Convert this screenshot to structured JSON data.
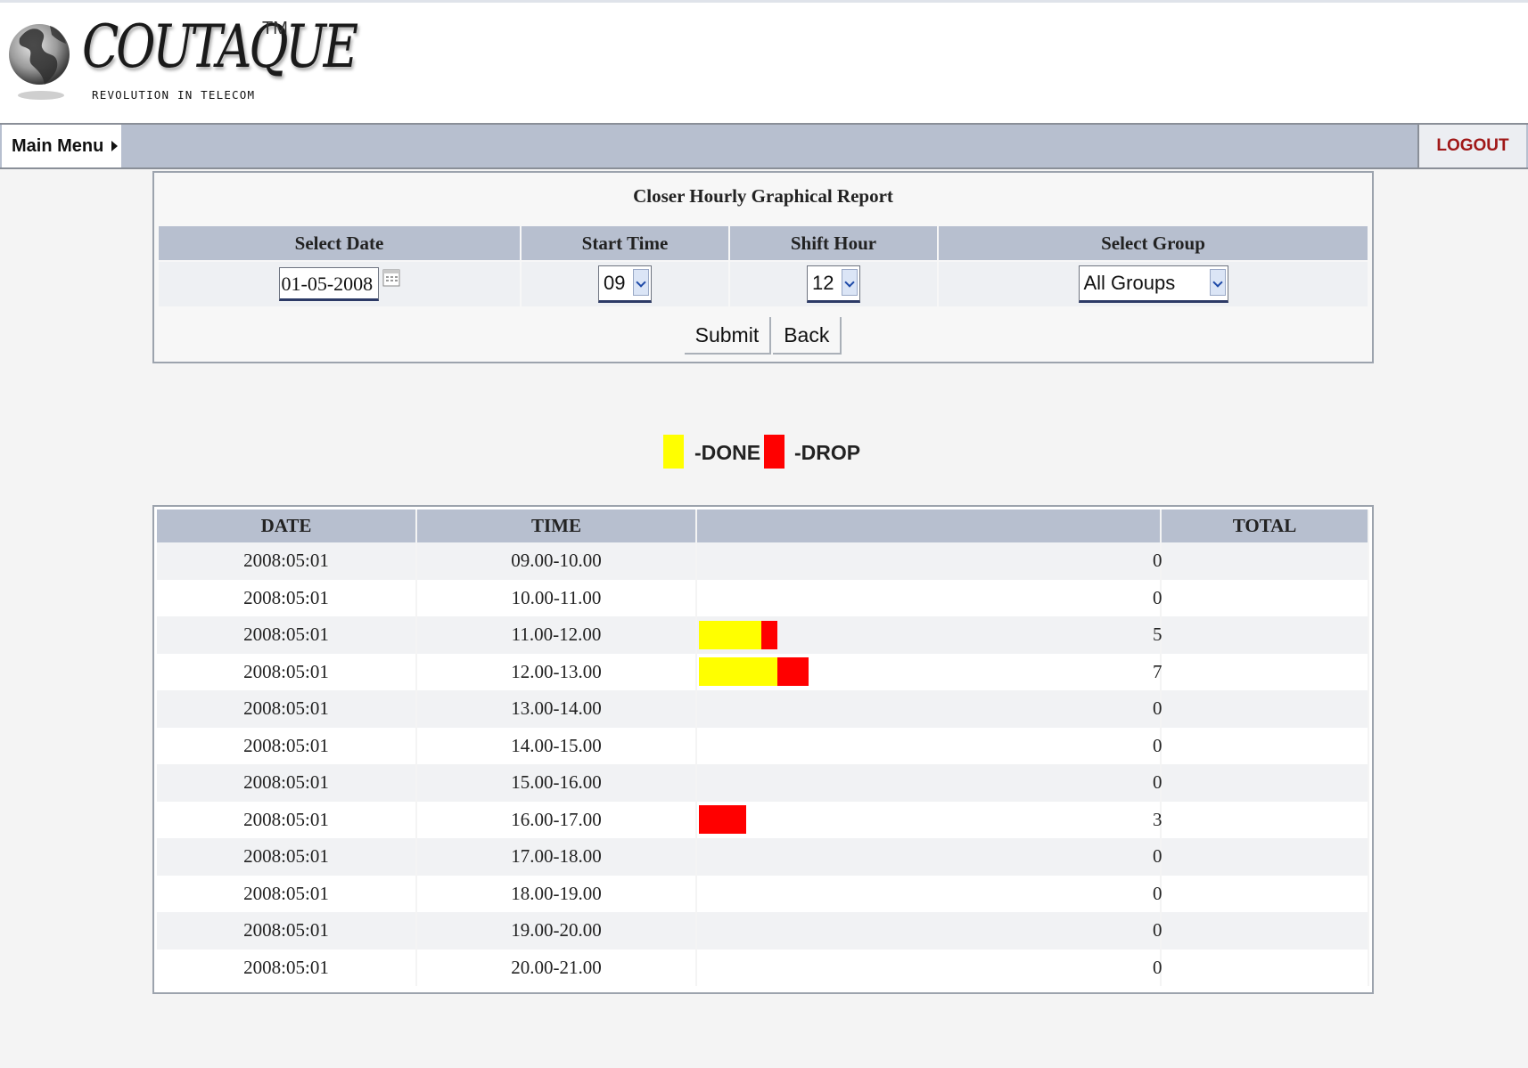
{
  "header": {
    "brand": "COUTAQUE",
    "trademark": "TM",
    "tagline": "REVOLUTION IN TELECOM"
  },
  "nav": {
    "main_menu_label": "Main Menu",
    "logout_label": "LOGOUT"
  },
  "form": {
    "title": "Closer Hourly Graphical Report",
    "columns": [
      "Select Date",
      "Start Time",
      "Shift Hour",
      "Select Group"
    ],
    "date_value": "01-05-2008",
    "start_time": "09",
    "shift_hour": "12",
    "group": "All Groups",
    "submit_label": "Submit",
    "back_label": "Back"
  },
  "legend": {
    "done_label": "-DONE",
    "drop_label": "-DROP",
    "done_color": "#ffff00",
    "drop_color": "#ff0000"
  },
  "table": {
    "headers": [
      "DATE",
      "TIME",
      "",
      "TOTAL"
    ],
    "rows": [
      {
        "date": "2008:05:01",
        "time": "09.00-10.00",
        "done": 0,
        "drop": 0,
        "total": "0"
      },
      {
        "date": "2008:05:01",
        "time": "10.00-11.00",
        "done": 0,
        "drop": 0,
        "total": "0"
      },
      {
        "date": "2008:05:01",
        "time": "11.00-12.00",
        "done": 4,
        "drop": 1,
        "total": "5"
      },
      {
        "date": "2008:05:01",
        "time": "12.00-13.00",
        "done": 5,
        "drop": 2,
        "total": "7"
      },
      {
        "date": "2008:05:01",
        "time": "13.00-14.00",
        "done": 0,
        "drop": 0,
        "total": "0"
      },
      {
        "date": "2008:05:01",
        "time": "14.00-15.00",
        "done": 0,
        "drop": 0,
        "total": "0"
      },
      {
        "date": "2008:05:01",
        "time": "15.00-16.00",
        "done": 0,
        "drop": 0,
        "total": "0"
      },
      {
        "date": "2008:05:01",
        "time": "16.00-17.00",
        "done": 0,
        "drop": 3,
        "total": "3"
      },
      {
        "date": "2008:05:01",
        "time": "17.00-18.00",
        "done": 0,
        "drop": 0,
        "total": "0"
      },
      {
        "date": "2008:05:01",
        "time": "18.00-19.00",
        "done": 0,
        "drop": 0,
        "total": "0"
      },
      {
        "date": "2008:05:01",
        "time": "19.00-20.00",
        "done": 0,
        "drop": 0,
        "total": "0"
      },
      {
        "date": "2008:05:01",
        "time": "20.00-21.00",
        "done": 0,
        "drop": 0,
        "total": "0"
      }
    ]
  }
}
